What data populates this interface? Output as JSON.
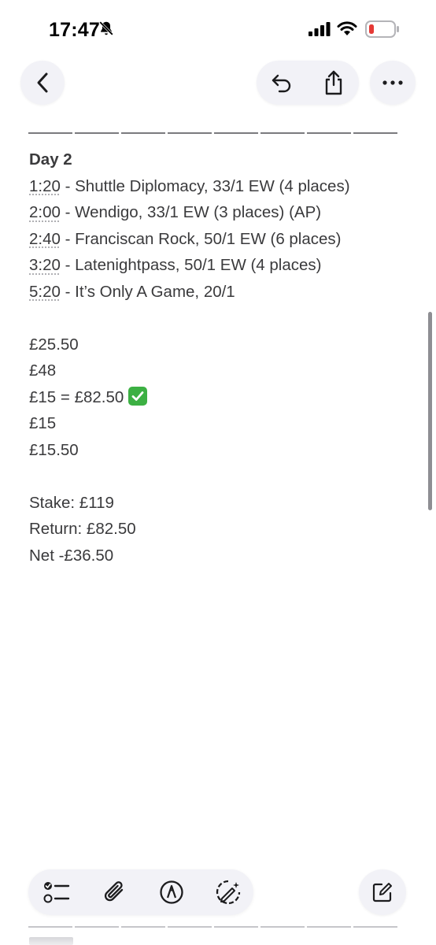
{
  "status_bar": {
    "time": "17:47",
    "icons": [
      "bell-slash-icon",
      "cellular-signal-icon",
      "wifi-icon",
      "battery-low-icon"
    ],
    "battery_color": "#e53935"
  },
  "header": {
    "buttons": [
      "back-chevron-icon",
      "undo-icon",
      "share-icon",
      "more-ellipsis-icon"
    ]
  },
  "note": {
    "day_title": "Day 2",
    "races": [
      {
        "time": "1:20",
        "text": " - Shuttle Diplomacy, 33/1 EW (4 places)"
      },
      {
        "time": "2:00",
        "text": " - Wendigo, 33/1 EW (3 places) (AP)"
      },
      {
        "time": "2:40",
        "text": " - Franciscan Rock, 50/1 EW (6 places)"
      },
      {
        "time": "3:20",
        "text": " - Latenightpass, 50/1 EW (4 places)"
      },
      {
        "time": "5:20",
        "text": " - It’s Only A Game, 20/1"
      }
    ],
    "stakes": [
      "£25.50",
      "£48",
      "£15 = £82.50",
      "£15",
      "£15.50"
    ],
    "win_marker": "check-mark-emoji",
    "summary": {
      "stake": "Stake: £119",
      "return": "Return: £82.50",
      "net": "Net -£36.50"
    }
  },
  "toolbar": {
    "buttons": [
      "checklist-icon",
      "paperclip-icon",
      "markup-pen-icon",
      "writing-tools-icon",
      "compose-icon"
    ]
  },
  "colors": {
    "accent_check": "#3cb043",
    "button_bg": "#f2f2f7",
    "text": "#3a3a3c"
  }
}
